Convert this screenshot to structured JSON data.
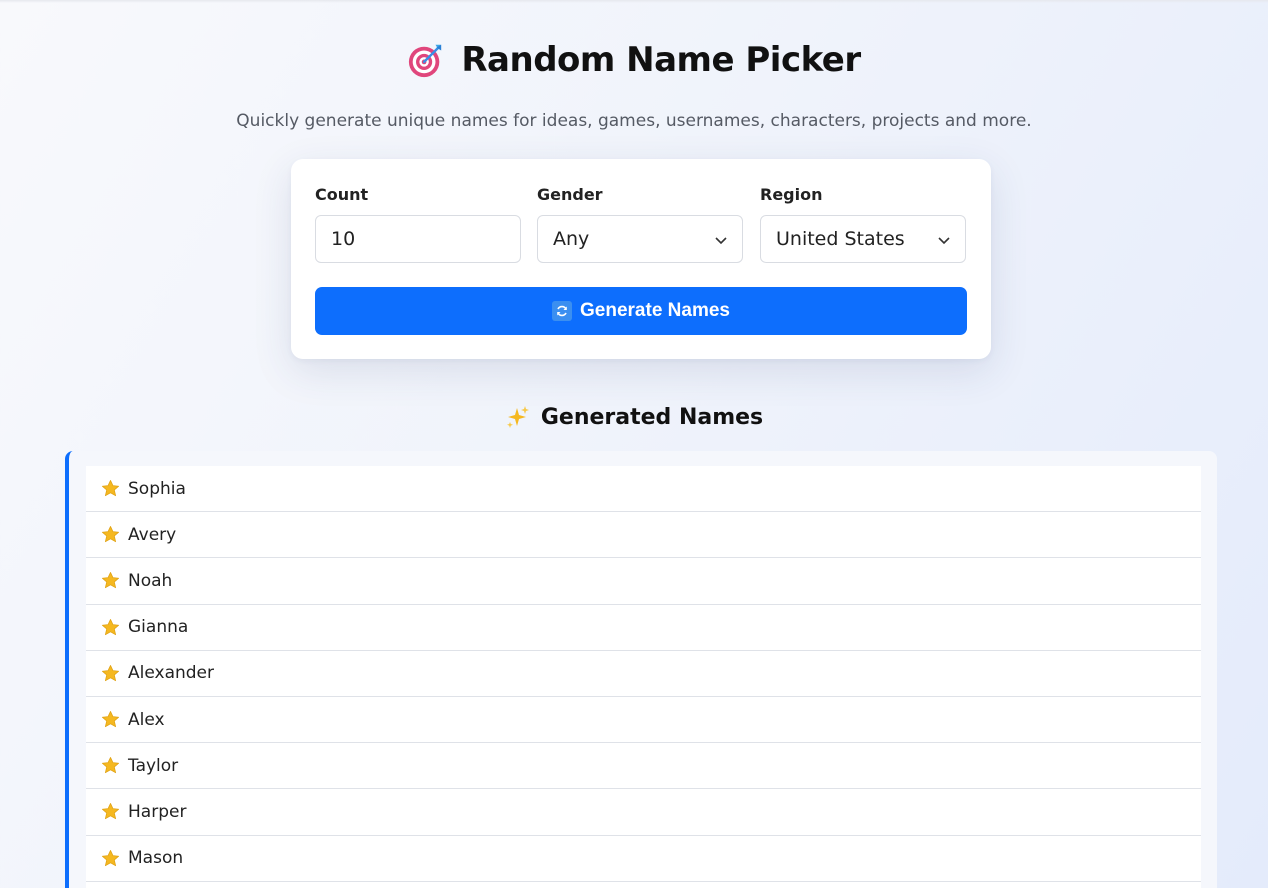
{
  "header": {
    "title": "Random Name Picker",
    "title_icon": "target-dart-icon",
    "subtitle": "Quickly generate unique names for ideas, games, usernames, characters, projects and more."
  },
  "form": {
    "count": {
      "label": "Count",
      "value": "10"
    },
    "gender": {
      "label": "Gender",
      "value": "Any"
    },
    "region": {
      "label": "Region",
      "value": "United States"
    },
    "generate_button": {
      "label": "Generate Names",
      "icon": "refresh-icon"
    }
  },
  "results": {
    "title": "Generated Names",
    "title_icon": "sparkles-icon",
    "item_icon": "star-icon",
    "names": [
      "Sophia",
      "Avery",
      "Noah",
      "Gianna",
      "Alexander",
      "Alex",
      "Taylor",
      "Harper",
      "Mason",
      ""
    ]
  },
  "colors": {
    "accent": "#0d6efd",
    "background": "#eef2fb",
    "card": "#ffffff",
    "star": "#f5b820"
  }
}
